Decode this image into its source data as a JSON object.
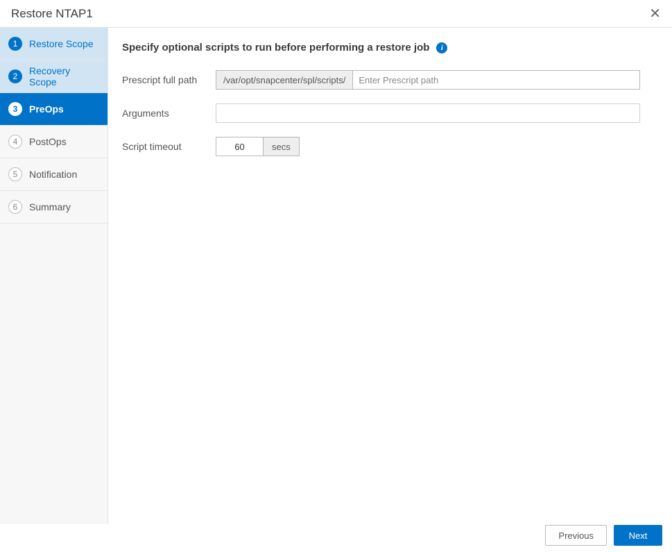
{
  "header": {
    "title": "Restore NTAP1"
  },
  "sidebar": {
    "steps": [
      {
        "num": "1",
        "label": "Restore Scope",
        "state": "completed"
      },
      {
        "num": "2",
        "label": "Recovery Scope",
        "state": "completed"
      },
      {
        "num": "3",
        "label": "PreOps",
        "state": "active"
      },
      {
        "num": "4",
        "label": "PostOps",
        "state": "upcoming"
      },
      {
        "num": "5",
        "label": "Notification",
        "state": "upcoming"
      },
      {
        "num": "6",
        "label": "Summary",
        "state": "upcoming"
      }
    ]
  },
  "content": {
    "heading": "Specify optional scripts to run before performing a restore job",
    "prescript": {
      "label": "Prescript full path",
      "prefix": "/var/opt/snapcenter/spl/scripts/",
      "placeholder": "Enter Prescript path",
      "value": ""
    },
    "arguments": {
      "label": "Arguments",
      "value": ""
    },
    "timeout": {
      "label": "Script timeout",
      "value": "60",
      "unit": "secs"
    }
  },
  "footer": {
    "previous": "Previous",
    "next": "Next"
  }
}
